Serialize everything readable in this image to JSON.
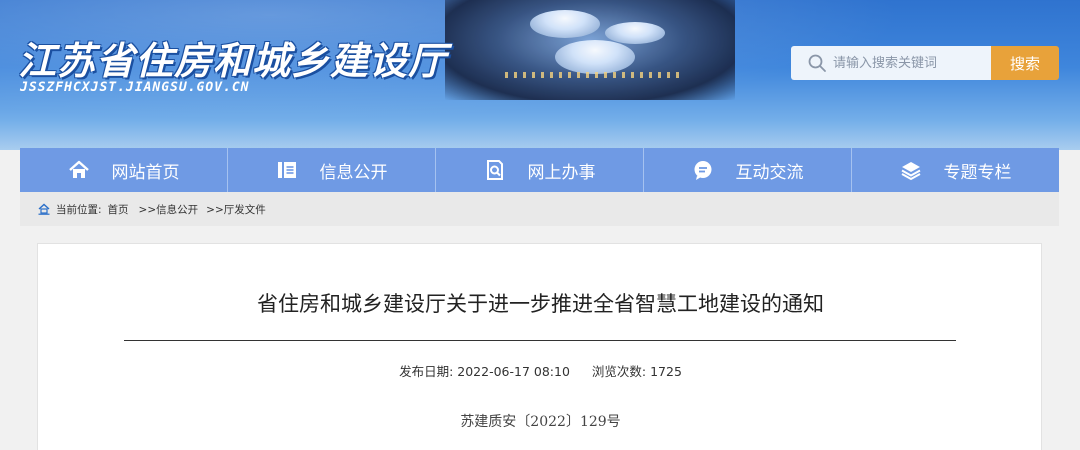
{
  "header": {
    "site_title": "江苏省住房和城乡建设厅",
    "site_domain": "JSSZFHCXJST.JIANGSU.GOV.CN",
    "search": {
      "placeholder": "请输入搜索关键词",
      "button_label": "搜索",
      "icon": "search-icon"
    }
  },
  "nav": {
    "items": [
      {
        "label": "网站首页",
        "icon": "home-icon"
      },
      {
        "label": "信息公开",
        "icon": "document-icon"
      },
      {
        "label": "网上办事",
        "icon": "search-document-icon"
      },
      {
        "label": "互动交流",
        "icon": "chat-icon"
      },
      {
        "label": "专题专栏",
        "icon": "layers-icon"
      }
    ]
  },
  "breadcrumb": {
    "prefix": "当前位置:",
    "items": [
      "首页",
      ">>信息公开",
      ">>厅发文件"
    ]
  },
  "article": {
    "title": "省住房和城乡建设厅关于进一步推进全省智慧工地建设的通知",
    "publish_label": "发布日期:",
    "publish_date": "2022-06-17 08:10",
    "views_label": "浏览次数:",
    "views": "1725",
    "doc_number": "苏建质安〔2022〕129号"
  },
  "colors": {
    "nav_bg": "#6f9ae4",
    "search_button": "#e8a23a",
    "header_blue": "#3f86dc"
  }
}
